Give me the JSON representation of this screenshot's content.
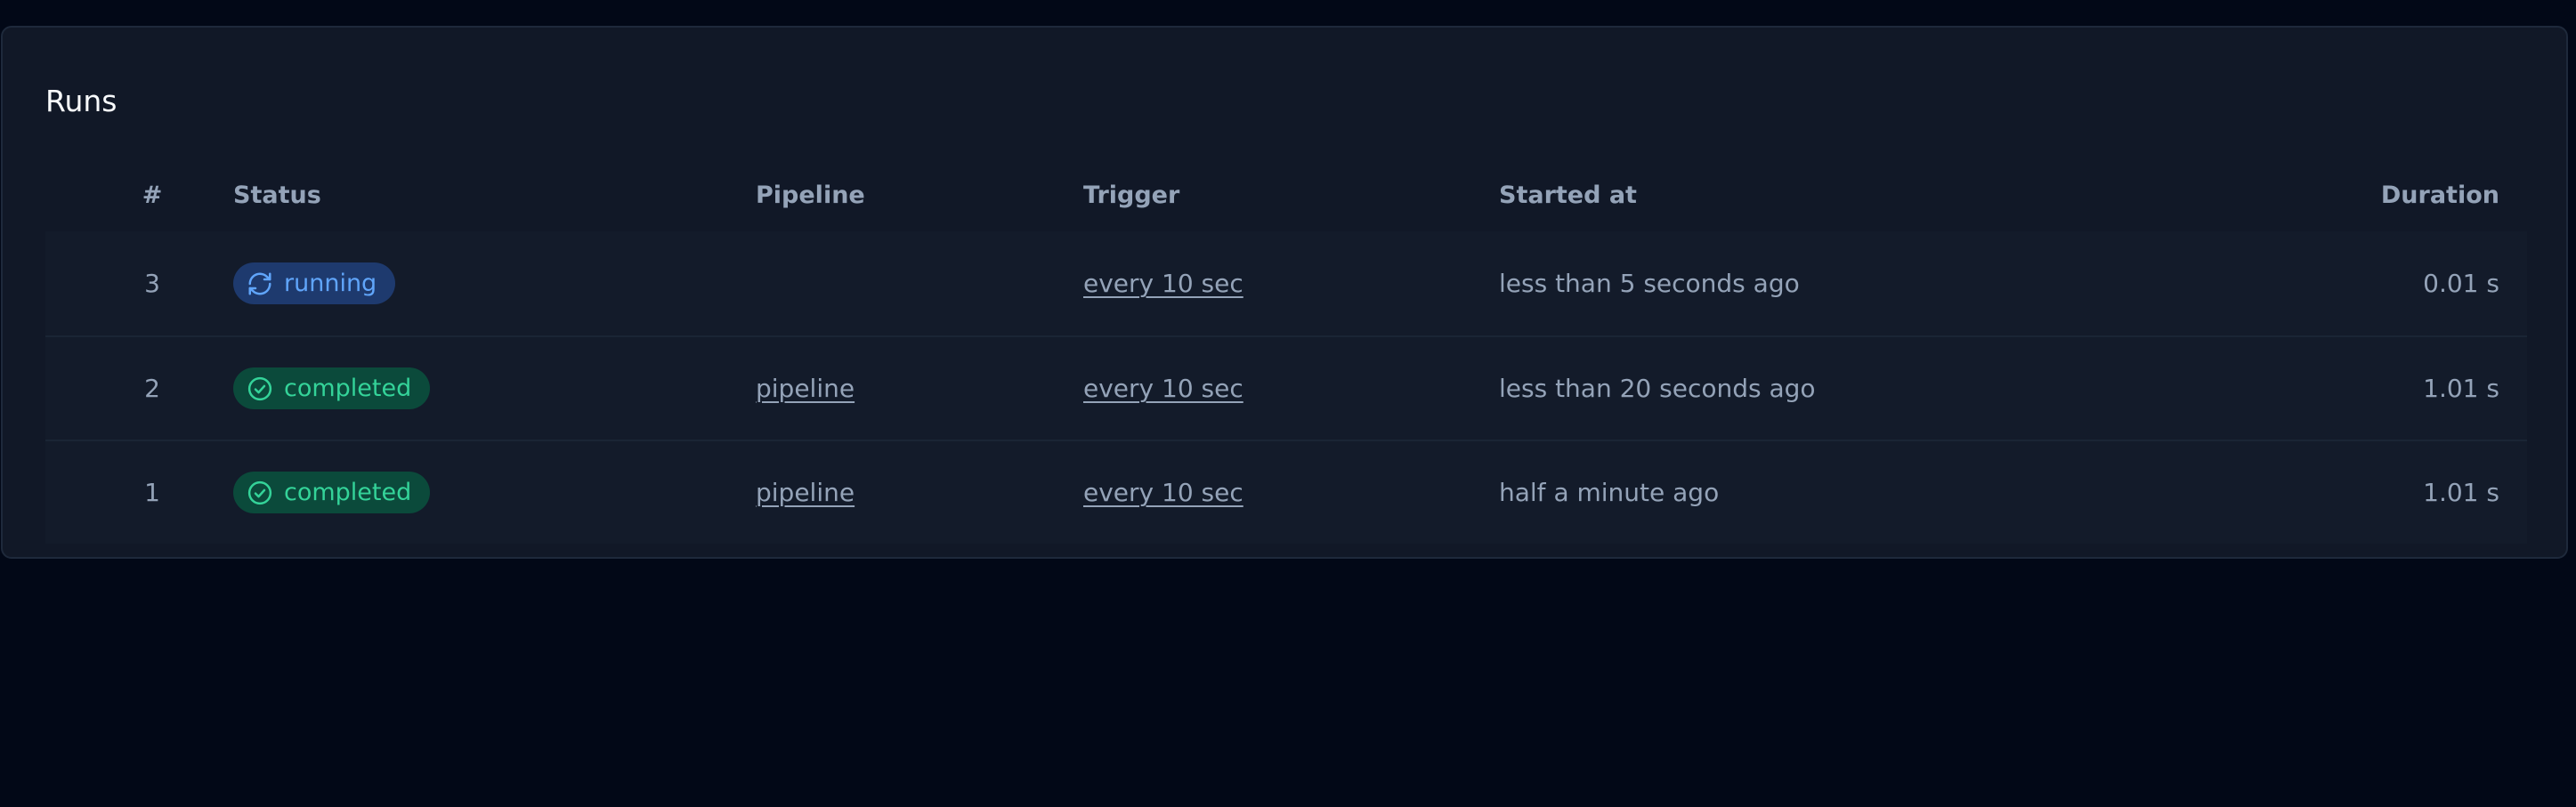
{
  "card": {
    "title": "Runs"
  },
  "table": {
    "columns": {
      "num": "#",
      "status": "Status",
      "pipeline": "Pipeline",
      "trigger": "Trigger",
      "started_at": "Started at",
      "duration": "Duration"
    },
    "rows": [
      {
        "num": "3",
        "status": "running",
        "status_icon": "refresh-icon",
        "pipeline": "",
        "trigger": "every 10 sec",
        "started_at": "less than 5 seconds ago",
        "duration": "0.01 s"
      },
      {
        "num": "2",
        "status": "completed",
        "status_icon": "check-circle-icon",
        "pipeline": "pipeline",
        "trigger": "every 10 sec",
        "started_at": "less than 20 seconds ago",
        "duration": "1.01 s"
      },
      {
        "num": "1",
        "status": "completed",
        "status_icon": "check-circle-icon",
        "pipeline": "pipeline",
        "trigger": "every 10 sec",
        "started_at": "half a minute ago",
        "duration": "1.01 s"
      }
    ]
  },
  "colors": {
    "page_background": "#020817",
    "card_background": "#111827",
    "running": "#60a5fa",
    "completed": "#34d399"
  }
}
